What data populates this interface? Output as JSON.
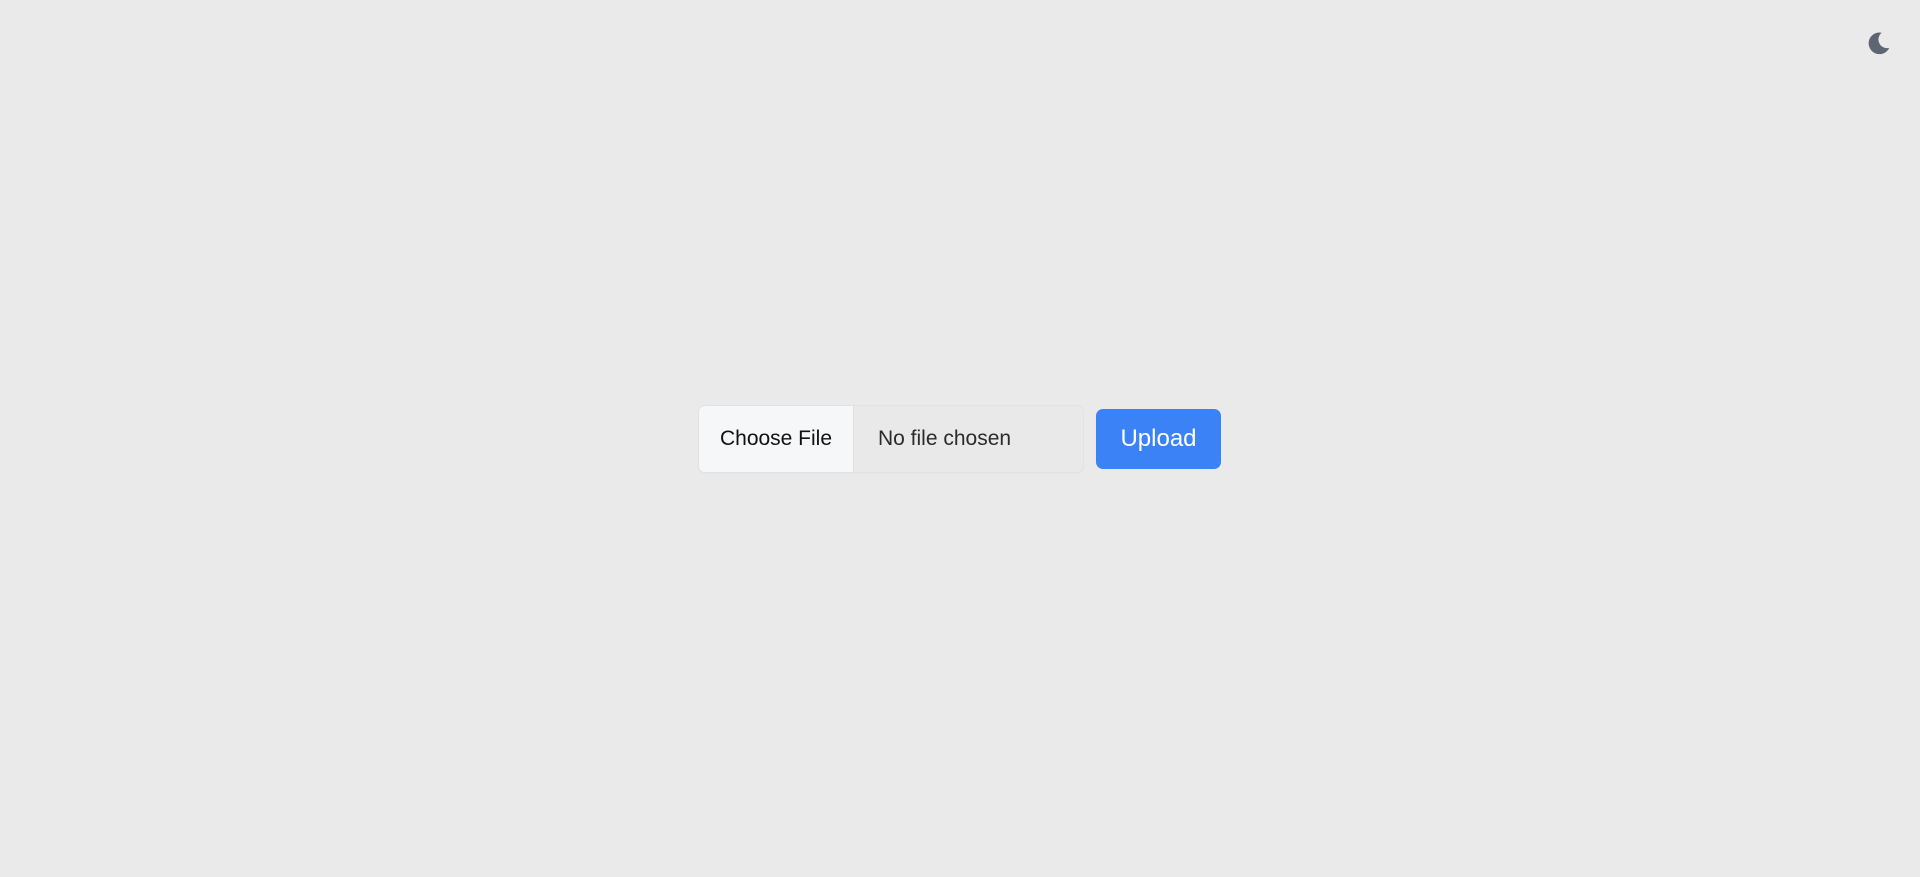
{
  "header": {
    "theme_toggle_icon": "moon-icon"
  },
  "upload": {
    "choose_file_label": "Choose File",
    "file_status": "No file chosen",
    "upload_label": "Upload"
  },
  "colors": {
    "background": "#eaeaea",
    "accent": "#3b82f6",
    "icon": "#5f6673"
  }
}
